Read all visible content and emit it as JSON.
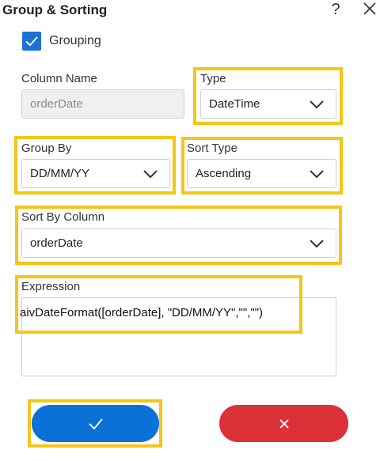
{
  "dialog": {
    "title": "Group & Sorting",
    "help_glyph": "?",
    "grouping": {
      "label": "Grouping",
      "checked": true
    },
    "column_name": {
      "label": "Column Name",
      "value": "orderDate"
    },
    "type": {
      "label": "Type",
      "value": "DateTime"
    },
    "group_by": {
      "label": "Group By",
      "value": "DD/MM/YY"
    },
    "sort_type": {
      "label": "Sort Type",
      "value": "Ascending"
    },
    "sort_by_column": {
      "label": "Sort By Column",
      "value": "orderDate"
    },
    "expression": {
      "label": "Expression",
      "value": "aivDateFormat([orderDate], \"DD/MM/YY\",\"\",\"\")"
    }
  },
  "icons": {
    "close": "close-icon",
    "check": "check-icon",
    "chevron": "chevron-down-icon",
    "confirm": "check-icon",
    "cancel": "close-icon"
  },
  "colors": {
    "primary": "#0a72d6",
    "danger": "#dc3139",
    "highlight": "#f5c518",
    "checkbox": "#1a73d4"
  }
}
